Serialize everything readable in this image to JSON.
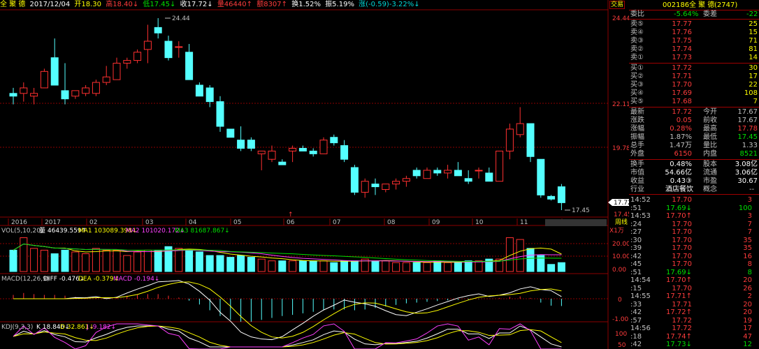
{
  "header": {
    "name": "全 聚 德",
    "date": "2017/12/04",
    "open": "开18.30",
    "high": "高18.40↓",
    "low": "低17.45↓",
    "close": "收17.72↓",
    "volume": "量46440↑",
    "amount": "额8307↑",
    "turnover": "换1.52%",
    "amplitude": "振5.19%",
    "change": "涨(-0.59)-3.22%↓"
  },
  "colors": {
    "up": "#ff3030",
    "down": "#54ffff",
    "grid": "#8b0000",
    "bg": "#000000"
  },
  "main_chart": {
    "price_axis": [
      "24.44",
      "22.11",
      "19.78"
    ],
    "current_price_tag": "17.72",
    "bottom_price": "17.45",
    "high_label": "24.44",
    "low_label": "17.45",
    "period_label": "周线",
    "x_labels": [
      "2016",
      "2017",
      "02",
      "03",
      "04",
      "05",
      "06",
      "07",
      "08",
      "09",
      "10",
      "11",
      "12"
    ]
  },
  "vol_panel": {
    "title": "VOL(5,10,20)",
    "v": "量 46439.559↑",
    "ma1": "MA1 103089.398↓",
    "ma2": "MA2 101020.172↓",
    "ma3": "MA3 81687.867↓",
    "unit": "X1万",
    "axis": [
      "20.00",
      "10.00",
      "0.00"
    ]
  },
  "macd_panel": {
    "title": "MACD(12,26,9)",
    "diff": "DIFF -0.476↓",
    "dea": "DEA -0.379↓",
    "macd": "MACD -0.194↓",
    "axis": [
      "0",
      "-1.00"
    ]
  },
  "kdj_panel": {
    "title": "KDJ(9,3,3)",
    "k": "K 18.846↓",
    "d": "D 32.861↓",
    "j": "J -9.182↓",
    "axis": [
      "100",
      "50"
    ]
  },
  "chart_data": {
    "type": "candlestick",
    "series_candles": [
      [
        21.7,
        21.9,
        21.3,
        21.6
      ],
      [
        21.7,
        22.1,
        21.4,
        21.9
      ],
      [
        21.6,
        21.9,
        21.3,
        21.7
      ],
      [
        21.9,
        22.6,
        21.9,
        22.5
      ],
      [
        23.0,
        23.7,
        22.0,
        22.0
      ],
      [
        21.8,
        22.8,
        21.3,
        21.5
      ],
      [
        21.6,
        21.8,
        21.5,
        21.8
      ],
      [
        21.7,
        22.0,
        21.6,
        21.9
      ],
      [
        21.7,
        22.2,
        21.6,
        22.1
      ],
      [
        22.1,
        22.7,
        22.0,
        22.3
      ],
      [
        22.2,
        23.0,
        22.2,
        22.8
      ],
      [
        22.8,
        23.0,
        22.6,
        22.9
      ],
      [
        22.9,
        23.3,
        22.8,
        23.2
      ],
      [
        23.3,
        24.2,
        22.8,
        23.6
      ],
      [
        24.1,
        24.44,
        23.7,
        23.9
      ],
      [
        23.6,
        23.8,
        22.9,
        23.0
      ],
      [
        23.4,
        23.6,
        23.0,
        23.4
      ],
      [
        23.2,
        23.5,
        22.7,
        22.2
      ],
      [
        22.0,
        22.1,
        21.6,
        21.6
      ],
      [
        21.9,
        22.0,
        21.2,
        21.4
      ],
      [
        21.4,
        21.6,
        20.3,
        20.5
      ],
      [
        20.4,
        20.4,
        20.1,
        20.1
      ],
      [
        20.0,
        20.5,
        19.6,
        19.7
      ],
      [
        20.0,
        20.1,
        19.6,
        19.7
      ],
      [
        19.5,
        19.5,
        18.9,
        19.6
      ],
      [
        19.3,
        19.8,
        19.2,
        19.6
      ],
      [
        19.2,
        19.3,
        19.1,
        19.1
      ],
      [
        19.6,
        19.8,
        19.2,
        19.7
      ],
      [
        19.7,
        19.8,
        19.6,
        19.6
      ],
      [
        19.6,
        19.7,
        19.4,
        19.5
      ],
      [
        19.5,
        20.1,
        19.5,
        20.0
      ],
      [
        20.1,
        20.2,
        19.8,
        19.9
      ],
      [
        19.8,
        20.0,
        19.2,
        19.3
      ],
      [
        19.0,
        19.1,
        18.0,
        18.1
      ],
      [
        18.1,
        18.6,
        17.9,
        18.5
      ],
      [
        18.4,
        18.6,
        18.0,
        18.3
      ],
      [
        18.2,
        18.3,
        18.1,
        18.4
      ],
      [
        18.4,
        18.6,
        18.2,
        18.5
      ],
      [
        18.5,
        18.7,
        18.3,
        18.6
      ],
      [
        18.9,
        19.0,
        18.6,
        18.7
      ],
      [
        18.6,
        19.0,
        18.6,
        18.9
      ],
      [
        18.9,
        19.0,
        18.7,
        18.8
      ],
      [
        18.8,
        19.1,
        18.6,
        18.9
      ],
      [
        18.9,
        19.2,
        18.7,
        18.7
      ],
      [
        18.6,
        18.9,
        18.4,
        18.5
      ],
      [
        18.9,
        19.0,
        18.6,
        18.9
      ],
      [
        18.8,
        19.0,
        18.6,
        18.5
      ],
      [
        18.5,
        19.5,
        18.5,
        19.6
      ],
      [
        19.6,
        20.6,
        19.3,
        20.4
      ],
      [
        20.2,
        21.2,
        20.1,
        20.6
      ],
      [
        20.6,
        20.6,
        19.2,
        19.4
      ],
      [
        19.3,
        19.3,
        17.9,
        18.0
      ],
      [
        17.95,
        18.0,
        17.8,
        17.85
      ],
      [
        18.3,
        18.4,
        17.45,
        17.72
      ]
    ],
    "volume": [
      12,
      19,
      13,
      12,
      10,
      12,
      11,
      10,
      13,
      12,
      12,
      9,
      11,
      12,
      12,
      14,
      13,
      12,
      11,
      9,
      9,
      8,
      9,
      8,
      7,
      6,
      6,
      6,
      6,
      6,
      6,
      5,
      6,
      6,
      7,
      6,
      6,
      5,
      5,
      5,
      5,
      6,
      5,
      5,
      6,
      6,
      7,
      7,
      19,
      18,
      13,
      9,
      4,
      5
    ],
    "macd_hist": [
      0.1,
      0.15,
      0.12,
      0.1,
      0.1,
      0.08,
      0.05,
      0.04,
      0.03,
      0.02,
      0.05,
      0.08,
      0.1,
      0.12,
      0.12,
      0.08,
      0.03,
      -0.05,
      -0.15,
      -0.3,
      -0.45,
      -0.55,
      -0.6,
      -0.6,
      -0.55,
      -0.5,
      -0.45,
      -0.42,
      -0.38,
      -0.34,
      -0.3,
      -0.28,
      -0.28,
      -0.3,
      -0.28,
      -0.24,
      -0.2,
      -0.16,
      -0.12,
      -0.1,
      -0.08,
      -0.06,
      -0.04,
      -0.03,
      -0.02,
      -0.01,
      0.0,
      0.02,
      0.05,
      0.06,
      0.02,
      -0.1,
      -0.18,
      -0.19
    ]
  },
  "quote_panel": {
    "code": "002186",
    "name": "全 聚 德",
    "market": "(2747)",
    "webi_label": "委比",
    "webi": "-5.64%",
    "weicha_label": "委差",
    "weicha": "-22",
    "asks": [
      {
        "label": "卖⑤",
        "price": "17.77",
        "vol": "25"
      },
      {
        "label": "卖④",
        "price": "17.76",
        "vol": "15"
      },
      {
        "label": "卖③",
        "price": "17.75",
        "vol": "71"
      },
      {
        "label": "卖②",
        "price": "17.74",
        "vol": "81"
      },
      {
        "label": "卖①",
        "price": "17.73",
        "vol": "14"
      }
    ],
    "bids": [
      {
        "label": "买①",
        "price": "17.72",
        "vol": "30"
      },
      {
        "label": "买②",
        "price": "17.71",
        "vol": "17"
      },
      {
        "label": "买③",
        "price": "17.70",
        "vol": "22"
      },
      {
        "label": "买④",
        "price": "17.69",
        "vol": "108"
      },
      {
        "label": "买⑤",
        "price": "17.68",
        "vol": "7"
      }
    ],
    "stats": [
      {
        "l1": "最新",
        "v1": "17.72",
        "c1": "#ff3c3c",
        "l2": "今开",
        "v2": "17.67",
        "c2": "#c0c0c0"
      },
      {
        "l1": "涨跌",
        "v1": "0.05",
        "c1": "#ff3c3c",
        "l2": "前收",
        "v2": "17.67",
        "c2": "#c0c0c0"
      },
      {
        "l1": "涨幅",
        "v1": "0.28%",
        "c1": "#ff3c3c",
        "l2": "最高",
        "v2": "17.78",
        "c2": "#ff3c3c"
      },
      {
        "l1": "振幅",
        "v1": "1.87%",
        "c1": "#c0c0c0",
        "l2": "最低",
        "v2": "17.45",
        "c2": "#00e000"
      },
      {
        "l1": "总手",
        "v1": "1.47万",
        "c1": "#c0c0c0",
        "l2": "量比",
        "v2": "1.33",
        "c2": "#c0c0c0"
      },
      {
        "l1": "外盘",
        "v1": "6150",
        "c1": "#ff3c3c",
        "l2": "内盘",
        "v2": "8521",
        "c2": "#00e000"
      }
    ],
    "fund": [
      {
        "l1": "换手",
        "v1": "0.48%",
        "l2": "股本",
        "v2": "3.08亿"
      },
      {
        "l1": "市值",
        "v1": "54.66亿",
        "l2": "流通",
        "v2": "3.06亿"
      },
      {
        "l1": "收益",
        "v1": "0.43③",
        "l2": "市盈",
        "v2": "30.67"
      }
    ],
    "industry_label": "行业",
    "industry": "酒店餐饮",
    "concept_label": "概念",
    "concept": "--",
    "ticks": [
      {
        "t": "14:52",
        "p": "17.70",
        "v": "3",
        "c": "#ff3c3c"
      },
      {
        "t": ":51",
        "p": "17.69↓",
        "v": "100",
        "c": "#00e000"
      },
      {
        "t": "14:53",
        "p": "17.70↑",
        "v": "3",
        "c": "#ff3c3c"
      },
      {
        "t": ":24",
        "p": "17.70",
        "v": "7",
        "c": "#ff3c3c"
      },
      {
        "t": ":27",
        "p": "17.70",
        "v": "7",
        "c": "#ff3c3c"
      },
      {
        "t": ":30",
        "p": "17.70",
        "v": "35",
        "c": "#ff3c3c"
      },
      {
        "t": ":39",
        "p": "17.70",
        "v": "35",
        "c": "#ff3c3c"
      },
      {
        "t": ":42",
        "p": "17.70",
        "v": "16",
        "c": "#ff3c3c"
      },
      {
        "t": ":45",
        "p": "17.70",
        "v": "8",
        "c": "#ff3c3c"
      },
      {
        "t": ":51",
        "p": "17.69↓",
        "v": "8",
        "c": "#00e000"
      },
      {
        "t": "14:54",
        "p": "17.70↑",
        "v": "20",
        "c": "#ff3c3c"
      },
      {
        "t": ":15",
        "p": "17.70",
        "v": "26",
        "c": "#ff3c3c"
      },
      {
        "t": "14:55",
        "p": "17.71↑",
        "v": "2",
        "c": "#ff3c3c"
      },
      {
        "t": ":33",
        "p": "17.71",
        "v": "20",
        "c": "#ff3c3c"
      },
      {
        "t": ":42",
        "p": "17.72↑",
        "v": "20",
        "c": "#ff3c3c"
      },
      {
        "t": ":57",
        "p": "17.72",
        "v": "19",
        "c": "#ff3c3c"
      },
      {
        "t": "14:56",
        "p": "17.72",
        "v": "17",
        "c": "#ff3c3c"
      },
      {
        "t": ":18",
        "p": "17.74↑",
        "v": "47",
        "c": "#ff3c3c"
      },
      {
        "t": ":42",
        "p": "17.73↓",
        "v": "12",
        "c": "#00e000"
      }
    ],
    "tabs": [
      "交易",
      "周线"
    ]
  }
}
